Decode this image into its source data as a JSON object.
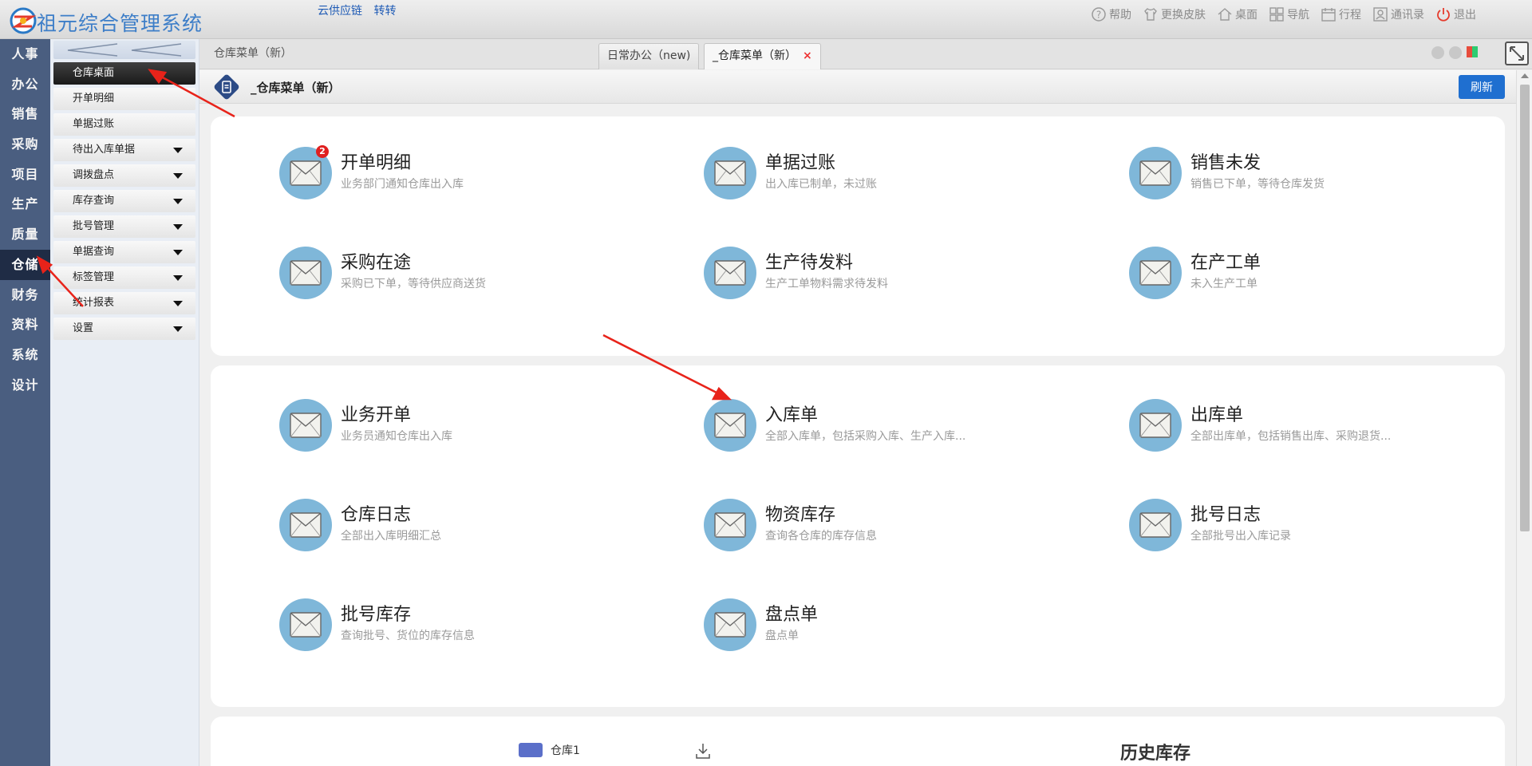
{
  "app": {
    "title": "祖元综合管理系统",
    "top_links": [
      "云供应链",
      "转转"
    ]
  },
  "toolbar": {
    "items": [
      {
        "label": "帮助",
        "icon": "help-icon"
      },
      {
        "label": "更换皮肤",
        "icon": "tshirt-icon"
      },
      {
        "label": "桌面",
        "icon": "home-icon"
      },
      {
        "label": "导航",
        "icon": "grid-icon"
      },
      {
        "label": "行程",
        "icon": "calendar-icon"
      },
      {
        "label": "通讯录",
        "icon": "contact-icon"
      },
      {
        "label": "退出",
        "icon": "power-icon"
      }
    ]
  },
  "categories": [
    "人事",
    "办公",
    "销售",
    "采购",
    "项目",
    "生产",
    "质量",
    "仓储",
    "财务",
    "资料",
    "系统",
    "设计"
  ],
  "active_category": "仓储",
  "submenu": [
    {
      "label": "仓库桌面",
      "active": true,
      "expandable": false
    },
    {
      "label": "开单明细",
      "active": false,
      "expandable": false
    },
    {
      "label": "单据过账",
      "active": false,
      "expandable": false
    },
    {
      "label": "待出入库单据",
      "active": false,
      "expandable": true
    },
    {
      "label": "调拨盘点",
      "active": false,
      "expandable": true
    },
    {
      "label": "库存查询",
      "active": false,
      "expandable": true
    },
    {
      "label": "批号管理",
      "active": false,
      "expandable": true
    },
    {
      "label": "单据查询",
      "active": false,
      "expandable": true
    },
    {
      "label": "标签管理",
      "active": false,
      "expandable": true
    },
    {
      "label": "统计报表",
      "active": false,
      "expandable": true
    },
    {
      "label": "设置",
      "active": false,
      "expandable": true
    }
  ],
  "tabs": {
    "crumb": "仓库菜单（新）",
    "items": [
      {
        "label": "日常办公（new)",
        "active": false,
        "closable": false
      },
      {
        "label": "_仓库菜单（新）",
        "active": true,
        "closable": true
      }
    ],
    "close_glyph": "×"
  },
  "page": {
    "title": "_仓库菜单（新）",
    "refresh_label": "刷新"
  },
  "panel1": [
    {
      "title": "开单明细",
      "desc": "业务部门通知仓库出入库",
      "badge": "2"
    },
    {
      "title": "单据过账",
      "desc": "出入库已制单，未过账"
    },
    {
      "title": "销售未发",
      "desc": "销售已下单，等待仓库发货"
    },
    {
      "title": "采购在途",
      "desc": "采购已下单，等待供应商送货"
    },
    {
      "title": "生产待发料",
      "desc": "生产工单物料需求待发料"
    },
    {
      "title": "在产工单",
      "desc": "未入生产工单"
    }
  ],
  "panel2": [
    {
      "title": "业务开单",
      "desc": "业务员通知仓库出入库"
    },
    {
      "title": "入库单",
      "desc": "全部入库单，包括采购入库、生产入库..."
    },
    {
      "title": "出库单",
      "desc": "全部出库单，包括销售出库、采购退货..."
    },
    {
      "title": "仓库日志",
      "desc": "全部出入库明细汇总"
    },
    {
      "title": "物资库存",
      "desc": "查询各仓库的库存信息"
    },
    {
      "title": "批号日志",
      "desc": "全部批号出入库记录"
    },
    {
      "title": "批号库存",
      "desc": "查询批号、货位的库存信息"
    },
    {
      "title": "盘点单",
      "desc": "盘点单"
    }
  ],
  "panel3": {
    "legend": "仓库1",
    "history_title": "历史库存"
  },
  "colors": {
    "catbar": "#4a5e80",
    "active_cat": "#1f2c45",
    "icon_circle": "#7fb7d9",
    "accent": "#1f6fd0",
    "badge": "#e02020",
    "annotation_arrow": "#e8231a"
  }
}
